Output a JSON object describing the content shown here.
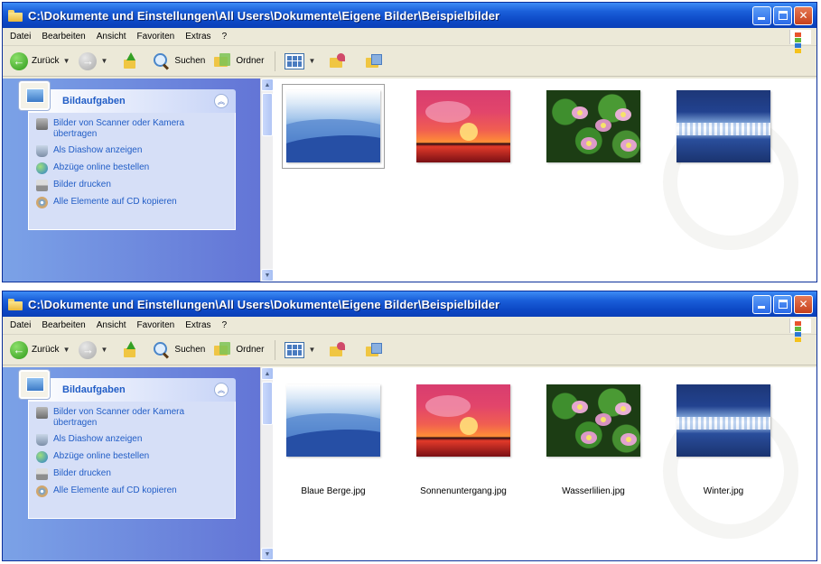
{
  "windows": [
    {
      "title": "C:\\Dokumente und Einstellungen\\All Users\\Dokumente\\Eigene Bilder\\Beispielbilder",
      "menu": [
        "Datei",
        "Bearbeiten",
        "Ansicht",
        "Favoriten",
        "Extras",
        "?"
      ],
      "toolbar": {
        "back": "Zurück",
        "search": "Suchen",
        "folders": "Ordner"
      },
      "taskpane": {
        "title": "Bildaufgaben",
        "items": [
          "Bilder von Scanner oder Kamera übertragen",
          "Als Diashow anzeigen",
          "Abzüge online bestellen",
          "Bilder drucken",
          "Alle Elemente auf CD kopieren"
        ]
      },
      "files": [
        {
          "name": "",
          "image": "blue-mountains"
        },
        {
          "name": "",
          "image": "sunset"
        },
        {
          "name": "",
          "image": "water-lilies"
        },
        {
          "name": "",
          "image": "winter"
        }
      ]
    },
    {
      "title": "C:\\Dokumente und Einstellungen\\All Users\\Dokumente\\Eigene Bilder\\Beispielbilder",
      "menu": [
        "Datei",
        "Bearbeiten",
        "Ansicht",
        "Favoriten",
        "Extras",
        "?"
      ],
      "toolbar": {
        "back": "Zurück",
        "search": "Suchen",
        "folders": "Ordner"
      },
      "taskpane": {
        "title": "Bildaufgaben",
        "items": [
          "Bilder von Scanner oder Kamera übertragen",
          "Als Diashow anzeigen",
          "Abzüge online bestellen",
          "Bilder drucken",
          "Alle Elemente auf CD kopieren"
        ]
      },
      "files": [
        {
          "name": "Blaue Berge.jpg",
          "image": "blue-mountains"
        },
        {
          "name": "Sonnenuntergang.jpg",
          "image": "sunset"
        },
        {
          "name": "Wasserlilien.jpg",
          "image": "water-lilies"
        },
        {
          "name": "Winter.jpg",
          "image": "winter"
        }
      ]
    }
  ],
  "colors": {
    "titlebar": "#0d49c6",
    "taskpane": "#6f8ddd",
    "task_link": "#215dc6",
    "close_button": "#c6401b"
  }
}
